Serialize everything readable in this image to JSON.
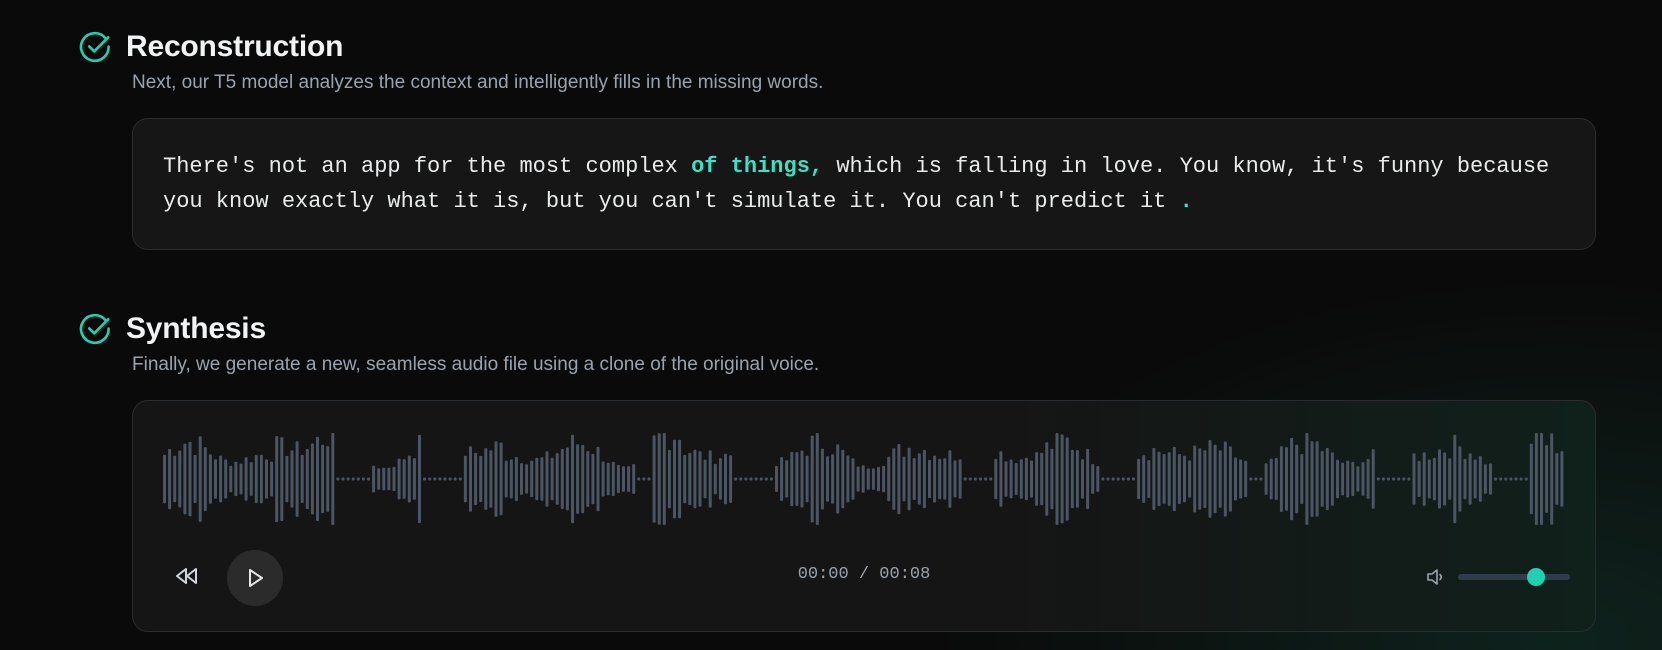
{
  "colors": {
    "accent": "#1fd1b0",
    "highlight_text": "#3ee0c3",
    "waveform": "#4b5563"
  },
  "reconstruction": {
    "icon": "check-circle-icon",
    "title": "Reconstruction",
    "subtitle": "Next, our T5 model analyzes the context and intelligently fills in the missing words.",
    "segments": [
      {
        "text": "There's not an app for the most complex ",
        "highlight": false
      },
      {
        "text": "of things,",
        "highlight": true
      },
      {
        "text": " which is falling in love. You know, it's funny because you know exactly what it is, but you can't simulate it. You can't predict it ",
        "highlight": false
      },
      {
        "text": ".",
        "highlight": true
      }
    ]
  },
  "synthesis": {
    "icon": "check-circle-icon",
    "title": "Synthesis",
    "subtitle": "Finally, we generate a new, seamless audio file using a clone of the original voice.",
    "player": {
      "current_time": "00:00",
      "duration": "00:08",
      "time_display": "00:00 / 00:08",
      "volume": 0.7,
      "rewind_icon": "rewind-icon",
      "play_icon": "play-icon",
      "volume_icon": "volume-icon"
    }
  }
}
